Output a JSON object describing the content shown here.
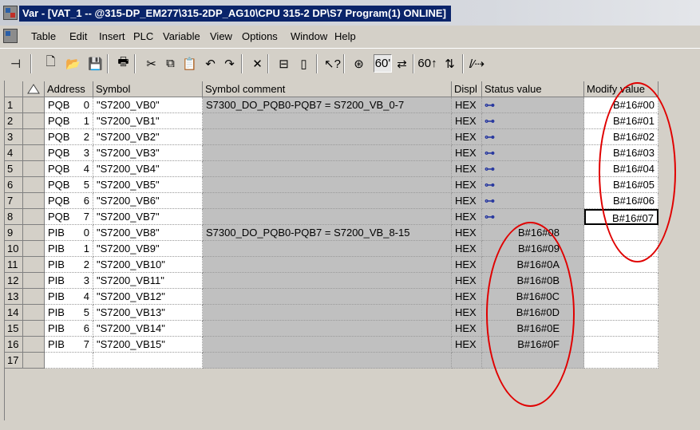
{
  "window": {
    "title": "Var - [VAT_1 -- @315-DP_EM277\\315-2DP_AG10\\CPU 315-2 DP\\S7 Program(1)  ONLINE]"
  },
  "menubar": {
    "items": [
      "Table",
      "Edit",
      "Insert",
      "PLC",
      "Variable",
      "View",
      "Options",
      "Window",
      "Help"
    ]
  },
  "toolbar": {
    "buttons": [
      {
        "name": "pin-icon",
        "glyph": "⊣"
      },
      {
        "name": "new-icon",
        "glyph": "🗋"
      },
      {
        "name": "open-icon",
        "glyph": "📂"
      },
      {
        "name": "save-icon",
        "glyph": "💾"
      },
      {
        "name": "print-icon",
        "glyph": "🖶"
      },
      {
        "name": "cut-icon",
        "glyph": "✂"
      },
      {
        "name": "copy-icon",
        "glyph": "⧉"
      },
      {
        "name": "paste-icon",
        "glyph": "📋"
      },
      {
        "name": "undo-icon",
        "glyph": "↶"
      },
      {
        "name": "redo-icon",
        "glyph": "↷"
      },
      {
        "name": "delete-icon",
        "glyph": "✕"
      },
      {
        "name": "network-icon",
        "glyph": "⊟"
      },
      {
        "name": "station-icon",
        "glyph": "▯"
      },
      {
        "name": "help-context-icon",
        "glyph": "↖?"
      },
      {
        "name": "monitor-icon",
        "glyph": "⊛"
      },
      {
        "name": "monitor-variable-icon",
        "glyph": "60'"
      },
      {
        "name": "modify-icon",
        "glyph": "⇄"
      },
      {
        "name": "update-monitor-icon",
        "glyph": "60↑"
      },
      {
        "name": "activate-modify-icon",
        "glyph": "⇅"
      },
      {
        "name": "enable-peripheral-icon",
        "glyph": "/⁄⇢"
      }
    ]
  },
  "table": {
    "headers": {
      "address": "Address",
      "symbol": "Symbol",
      "comment": "Symbol comment",
      "display": "Displ",
      "status": "Status value",
      "modify": "Modify value"
    },
    "rows": [
      {
        "n": "1",
        "type": "PQB",
        "idx": "0",
        "symbol": "\"S7200_VB0\"",
        "comment": "S7300_DO_PQB0-PQB7  =  S7200_VB_0-7",
        "disp": "HEX",
        "status": "",
        "modify": "B#16#00"
      },
      {
        "n": "2",
        "type": "PQB",
        "idx": "1",
        "symbol": "\"S7200_VB1\"",
        "comment": "",
        "disp": "HEX",
        "status": "",
        "modify": "B#16#01"
      },
      {
        "n": "3",
        "type": "PQB",
        "idx": "2",
        "symbol": "\"S7200_VB2\"",
        "comment": "",
        "disp": "HEX",
        "status": "",
        "modify": "B#16#02"
      },
      {
        "n": "4",
        "type": "PQB",
        "idx": "3",
        "symbol": "\"S7200_VB3\"",
        "comment": "",
        "disp": "HEX",
        "status": "",
        "modify": "B#16#03"
      },
      {
        "n": "5",
        "type": "PQB",
        "idx": "4",
        "symbol": "\"S7200_VB4\"",
        "comment": "",
        "disp": "HEX",
        "status": "",
        "modify": "B#16#04"
      },
      {
        "n": "6",
        "type": "PQB",
        "idx": "5",
        "symbol": "\"S7200_VB5\"",
        "comment": "",
        "disp": "HEX",
        "status": "",
        "modify": "B#16#05"
      },
      {
        "n": "7",
        "type": "PQB",
        "idx": "6",
        "symbol": "\"S7200_VB6\"",
        "comment": "",
        "disp": "HEX",
        "status": "",
        "modify": "B#16#06"
      },
      {
        "n": "8",
        "type": "PQB",
        "idx": "7",
        "symbol": "\"S7200_VB7\"",
        "comment": "",
        "disp": "HEX",
        "status": "",
        "modify": "B#16#07"
      },
      {
        "n": "9",
        "type": "PIB",
        "idx": "0",
        "symbol": "\"S7200_VB8\"",
        "comment": "S7300_DO_PQB0-PQB7  =  S7200_VB_8-15",
        "disp": "HEX",
        "status": "B#16#08",
        "modify": ""
      },
      {
        "n": "10",
        "type": "PIB",
        "idx": "1",
        "symbol": "\"S7200_VB9\"",
        "comment": "",
        "disp": "HEX",
        "status": "B#16#09",
        "modify": ""
      },
      {
        "n": "11",
        "type": "PIB",
        "idx": "2",
        "symbol": "\"S7200_VB10\"",
        "comment": "",
        "disp": "HEX",
        "status": "B#16#0A",
        "modify": ""
      },
      {
        "n": "12",
        "type": "PIB",
        "idx": "3",
        "symbol": "\"S7200_VB11\"",
        "comment": "",
        "disp": "HEX",
        "status": "B#16#0B",
        "modify": ""
      },
      {
        "n": "13",
        "type": "PIB",
        "idx": "4",
        "symbol": "\"S7200_VB12\"",
        "comment": "",
        "disp": "HEX",
        "status": "B#16#0C",
        "modify": ""
      },
      {
        "n": "14",
        "type": "PIB",
        "idx": "5",
        "symbol": "\"S7200_VB13\"",
        "comment": "",
        "disp": "HEX",
        "status": "B#16#0D",
        "modify": ""
      },
      {
        "n": "15",
        "type": "PIB",
        "idx": "6",
        "symbol": "\"S7200_VB14\"",
        "comment": "",
        "disp": "HEX",
        "status": "B#16#0E",
        "modify": ""
      },
      {
        "n": "16",
        "type": "PIB",
        "idx": "7",
        "symbol": "\"S7200_VB15\"",
        "comment": "",
        "disp": "HEX",
        "status": "B#16#0F",
        "modify": ""
      },
      {
        "n": "17",
        "type": "",
        "idx": "",
        "symbol": "",
        "comment": "",
        "disp": "",
        "status": "",
        "modify": ""
      }
    ]
  },
  "colors": {
    "title_bg": "#0a246a",
    "annotation_oval": "#e00000",
    "grey_cell": "#c0c0c0",
    "window_bg": "#d4d0c8"
  },
  "icons": {
    "status_glasses": "glasses-icon",
    "address_header_sort": "triangle-sort-icon"
  }
}
